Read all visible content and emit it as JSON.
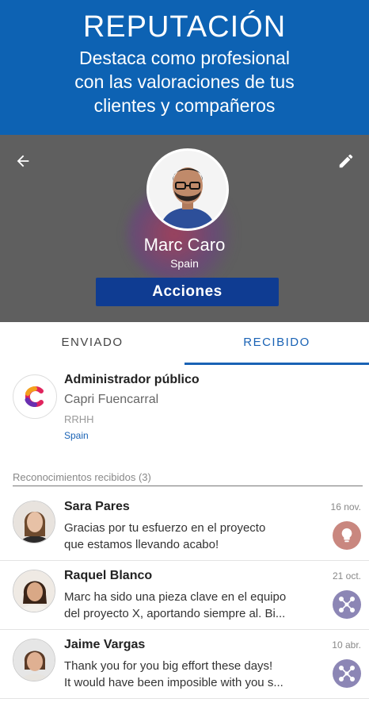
{
  "banner": {
    "title": "REPUTACIÓN",
    "subtitle_lines": [
      "Destaca como profesional",
      "con las valoraciones de tus",
      "clientes y compañeros"
    ]
  },
  "profile": {
    "name": "Marc Caro",
    "country": "Spain",
    "actions_label": "Acciones",
    "back_icon": "arrow-left-icon",
    "edit_icon": "pencil-icon"
  },
  "tabs": [
    {
      "label": "ENVIADO",
      "active": false
    },
    {
      "label": "RECIBIDO",
      "active": true
    }
  ],
  "company": {
    "name": "Administrador público",
    "place": "Capri Fuencarral",
    "department": "RRHH",
    "country": "Spain"
  },
  "section": {
    "label": "Reconocimientos recibidos (3)"
  },
  "recognitions": [
    {
      "name": "Sara Pares",
      "date": "16 nov.",
      "message_lines": [
        "Gracias por tu esfuerzo en el proyecto",
        "que estamos llevando acabo!"
      ],
      "badge_icon": "lightbulb-icon",
      "badge_color": "#c9877f"
    },
    {
      "name": "Raquel Blanco",
      "date": "21 oct.",
      "message_lines": [
        "Marc ha sido una pieza clave en el equipo",
        "del proyecto X, aportando siempre al. Bi..."
      ],
      "badge_icon": "network-icon",
      "badge_color": "#8c86b5"
    },
    {
      "name": "Jaime Vargas",
      "date": "10 abr.",
      "message_lines": [
        "Thank you for you big effort these days!",
        "It would have been imposible with you s..."
      ],
      "badge_icon": "network-icon",
      "badge_color": "#8c86b5"
    }
  ],
  "colors": {
    "banner_bg": "#0d62b3",
    "header_bg": "#5f5f5f",
    "actions_bg": "#0f3c92",
    "accent": "#1a63b5"
  }
}
